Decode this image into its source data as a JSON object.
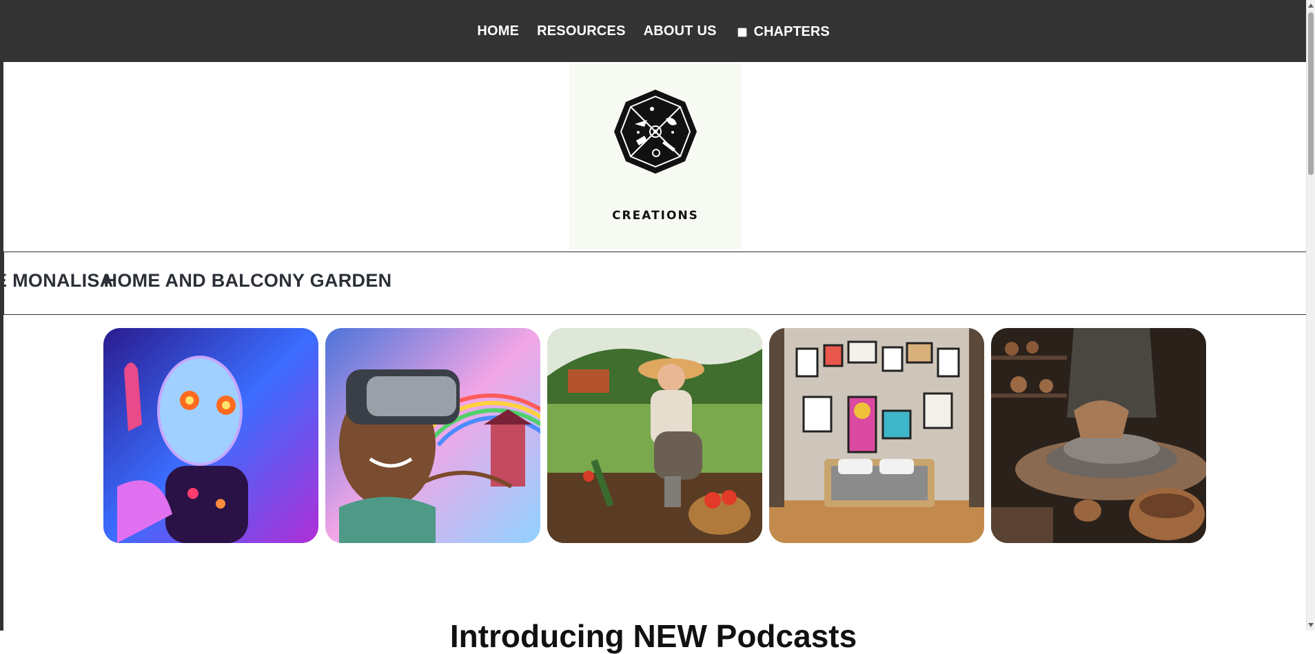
{
  "nav": {
    "home": "HOME",
    "resources": "RESOURCES",
    "about": "ABOUT US",
    "chapters": "CHAPTERS",
    "chapters_checked": false
  },
  "logo": {
    "text": "CREATIONS"
  },
  "marquee": {
    "items": [
      "E MONALISA",
      "HOME AND BALCONY GARDEN"
    ]
  },
  "gallery": {
    "items": [
      {
        "icon": "robot-image"
      },
      {
        "icon": "vr-headset-image"
      },
      {
        "icon": "gardening-woman-image"
      },
      {
        "icon": "bedroom-gallery-wall-image"
      },
      {
        "icon": "pottery-wheel-image"
      }
    ]
  },
  "section": {
    "heading": "Introducing NEW Podcasts"
  },
  "colors": {
    "nav_bg": "#333333",
    "text": "#2b2f36",
    "logo_bg": "#f7faf3"
  }
}
